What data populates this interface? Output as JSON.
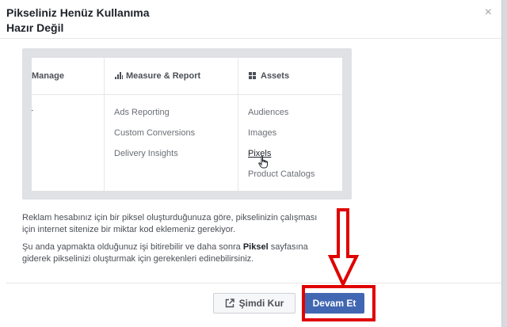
{
  "dialog": {
    "title_line1": "Pikseliniz Henüz Kullanıma",
    "title_line2": "Hazır Değil",
    "close_glyph": "×"
  },
  "screenshot": {
    "columns": [
      {
        "heading": "Manage",
        "items": [
          "r"
        ]
      },
      {
        "heading": "Measure & Report",
        "icon": "bar-chart-icon",
        "items": [
          "Ads Reporting",
          "Custom Conversions",
          "Delivery Insights"
        ]
      },
      {
        "heading": "Assets",
        "icon": "grid-icon",
        "items": [
          "Audiences",
          "Images",
          "Pixels",
          "Product Catalogs"
        ]
      }
    ]
  },
  "body": {
    "para1_line1": "Reklam hesabınız için bir piksel oluşturduğunuza göre, pikselinizin çalışması",
    "para1_line2": "için internet sitenize bir miktar kod eklemeniz gerekiyor.",
    "para2_line1_a": "Şu anda yapmakta olduğunuz işi bitirebilir ve daha sonra ",
    "para2_line1_bold": "Piksel",
    "para2_line1_b": " sayfasına",
    "para2_line2": "giderek pikselinizi oluşturmak için gerekenleri edinebilirsiniz."
  },
  "footer": {
    "install_now_label": "Şimdi Kur",
    "continue_label": "Devam Et"
  },
  "colors": {
    "primary": "#4267b2",
    "annotation": "#e00000"
  }
}
